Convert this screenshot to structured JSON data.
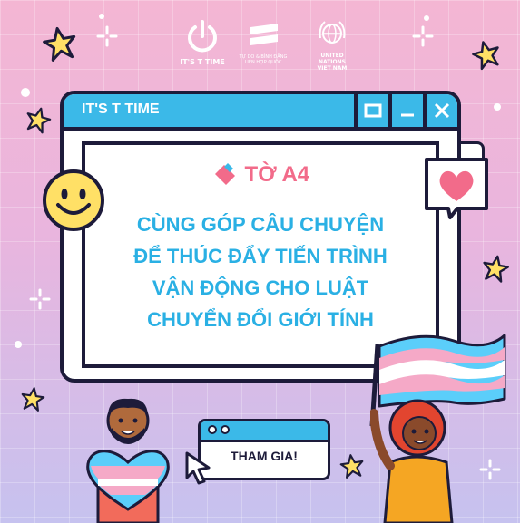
{
  "logos": {
    "its_t_time": "IT'S T TIME",
    "tu_do_line1": "TỰ DO & BÌNH ĐẲNG",
    "tu_do_line2": "LIÊN HỢP QUỐC",
    "un_line1": "UNITED",
    "un_line2": "NATIONS",
    "un_line3": "VIET NAM"
  },
  "window": {
    "title": "IT'S T TIME",
    "brand": "TỜ A4",
    "headline": [
      "CÙNG GÓP CÂU CHUYỆN",
      "ĐỂ THÚC ĐẨY TIẾN TRÌNH",
      "VẬN ĐỘNG CHO LUẬT",
      "CHUYỂN ĐỔI GIỚI TÍNH"
    ]
  },
  "join": {
    "label": "THAM GIA!"
  },
  "colors": {
    "accent_blue": "#3bb9e8",
    "headline_blue": "#2ab0e4",
    "brand_pink": "#f26b8a",
    "outline": "#1d1b3a",
    "trans_pink": "#f5a9c7",
    "trans_blue": "#5bcefa"
  },
  "icons": [
    "power-icon",
    "equals-icon",
    "un-emblem-icon",
    "maximize-icon",
    "minimize-icon",
    "close-icon",
    "pencil-icon",
    "smiley-icon",
    "heart-icon",
    "star-icon",
    "sparkle-icon",
    "cursor-icon",
    "trans-flag-icon",
    "trans-heart-icon"
  ]
}
